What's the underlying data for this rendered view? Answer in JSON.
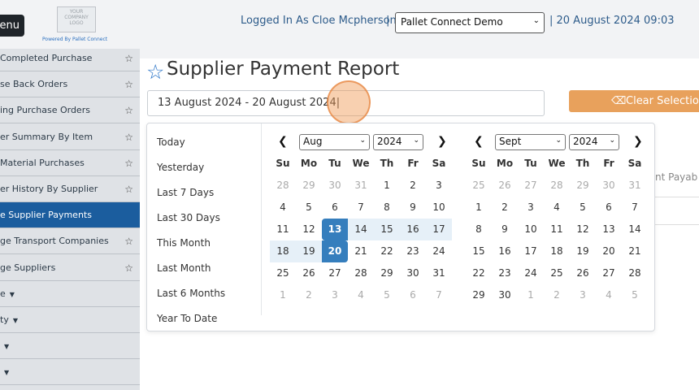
{
  "header": {
    "menu_label": "enu",
    "logo_text": "YOUR COMPANY LOGO",
    "powered_by": "Powered By Pallet Connect",
    "logged_in": "Logged In As Cloe Mcpherson",
    "separator": "|",
    "company_select": "Pallet Connect Demo",
    "datetime": "| 20 August 2024 09:03"
  },
  "sidebar": {
    "items": [
      {
        "label": "Completed Purchase",
        "star": true
      },
      {
        "label": "se Back Orders",
        "star": true
      },
      {
        "label": "ing Purchase Orders",
        "star": true
      },
      {
        "label": "er Summary By Item",
        "star": true
      },
      {
        "label": " Material Purchases",
        "star": true
      },
      {
        "label": "er History By Supplier",
        "star": true
      },
      {
        "label": "e Supplier Payments",
        "star": false
      },
      {
        "label": "ge Transport Companies",
        "star": true
      },
      {
        "label": "ge Suppliers",
        "star": true
      },
      {
        "label": "e",
        "caret": true
      },
      {
        "label": "ty",
        "caret": true
      },
      {
        "label": "",
        "caret": true
      },
      {
        "label": "",
        "caret": true
      }
    ]
  },
  "page": {
    "title": "Supplier Payment Report",
    "date_range_value": "13 August 2024 - 20 August 2024",
    "clear_button": "Clear Selection",
    "behind_text": "nt Payab"
  },
  "picker": {
    "ranges": [
      "Today",
      "Yesterday",
      "Last 7 Days",
      "Last 30 Days",
      "This Month",
      "Last Month",
      "Last 6 Months",
      "Year To Date"
    ],
    "dow": [
      "Su",
      "Mo",
      "Tu",
      "We",
      "Th",
      "Fr",
      "Sa"
    ],
    "left": {
      "month": "Aug",
      "year": "2024",
      "weeks": [
        [
          "28",
          "29",
          "30",
          "31",
          "1",
          "2",
          "3"
        ],
        [
          "4",
          "5",
          "6",
          "7",
          "8",
          "9",
          "10"
        ],
        [
          "11",
          "12",
          "13",
          "14",
          "15",
          "16",
          "17"
        ],
        [
          "18",
          "19",
          "20",
          "21",
          "22",
          "23",
          "24"
        ],
        [
          "25",
          "26",
          "27",
          "28",
          "29",
          "30",
          "31"
        ],
        [
          "1",
          "2",
          "3",
          "4",
          "5",
          "6",
          "7"
        ]
      ]
    },
    "right": {
      "month": "Sept",
      "year": "2024",
      "weeks": [
        [
          "25",
          "26",
          "27",
          "28",
          "29",
          "30",
          "31"
        ],
        [
          "1",
          "2",
          "3",
          "4",
          "5",
          "6",
          "7"
        ],
        [
          "8",
          "9",
          "10",
          "11",
          "12",
          "13",
          "14"
        ],
        [
          "15",
          "16",
          "17",
          "18",
          "19",
          "20",
          "21"
        ],
        [
          "22",
          "23",
          "24",
          "25",
          "26",
          "27",
          "28"
        ],
        [
          "29",
          "30",
          "1",
          "2",
          "3",
          "4",
          "5"
        ]
      ]
    },
    "selected_start": "13",
    "selected_end": "20"
  },
  "colors": {
    "accent_blue": "#357ebd",
    "sidebar_active": "#1b5d9e",
    "clear_button": "#e8a15c",
    "range_fill": "#e6f0f8"
  }
}
